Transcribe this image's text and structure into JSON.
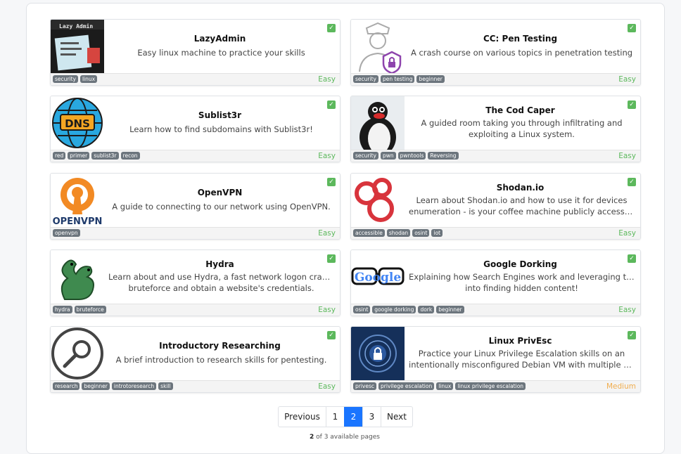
{
  "cards": [
    {
      "title": "LazyAdmin",
      "desc1": "Easy linux machine to practice your skills",
      "desc2": "",
      "tags": [
        "security",
        "linux"
      ],
      "difficulty": "Easy",
      "completed": true,
      "image": "lazyadmin-icon",
      "thumb_text": "Lazy Admin"
    },
    {
      "title": "CC: Pen Testing",
      "desc1": "A crash course on various topics in penetration testing",
      "desc2": "",
      "tags": [
        "security",
        "pen testing",
        "beginner"
      ],
      "difficulty": "Easy",
      "completed": true,
      "image": "security-guard-icon"
    },
    {
      "title": "Sublist3r",
      "desc1": "Learn how to find subdomains with Sublist3r!",
      "desc2": "",
      "tags": [
        "red",
        "primer",
        "sublist3r",
        "recon"
      ],
      "difficulty": "Easy",
      "completed": true,
      "image": "dns-globe-icon",
      "thumb_text": "DNS"
    },
    {
      "title": "The Cod Caper",
      "desc1": "A guided room taking you through infiltrating and",
      "desc2": "exploiting a Linux system.",
      "tags": [
        "security",
        "pwn",
        "pwntools",
        "Reversing"
      ],
      "difficulty": "Easy",
      "completed": true,
      "image": "penguin-icon"
    },
    {
      "title": "OpenVPN",
      "desc1": "A guide to connecting to our network using OpenVPN.",
      "desc2": "",
      "tags": [
        "openvpn"
      ],
      "difficulty": "Easy",
      "completed": true,
      "image": "openvpn-logo-icon",
      "thumb_text": "OPENVPN"
    },
    {
      "title": "Shodan.io",
      "desc1": "Learn about Shodan.io and how to use it for devices",
      "desc2": "enumeration - is your coffee machine publicly accessible?",
      "tags": [
        "accessible",
        "shodan",
        "osint",
        "iot"
      ],
      "difficulty": "Easy",
      "completed": true,
      "image": "shodan-logo-icon"
    },
    {
      "title": "Hydra",
      "desc1": "Learn about and use Hydra, a fast network logon cracker, to",
      "desc2": "bruteforce and obtain a website's credentials.",
      "tags": [
        "hydra",
        "bruteforce"
      ],
      "difficulty": "Easy",
      "completed": true,
      "image": "hydra-dragon-icon"
    },
    {
      "title": "Google Dorking",
      "desc1": "Explaining how Search Engines work and leveraging them",
      "desc2": "into finding hidden content!",
      "tags": [
        "osint",
        "google dorking",
        "dork",
        "beginner"
      ],
      "difficulty": "Easy",
      "completed": true,
      "image": "google-glasses-icon",
      "thumb_text": "Google"
    },
    {
      "title": "Introductory Researching",
      "desc1": "A brief introduction to research skills for pentesting.",
      "desc2": "",
      "tags": [
        "research",
        "beginner",
        "introtoresearch",
        "skill"
      ],
      "difficulty": "Easy",
      "completed": true,
      "image": "magnifier-icon"
    },
    {
      "title": "Linux PrivEsc",
      "desc1": "Practice your Linux Privilege Escalation skills on an",
      "desc2": "intentionally misconfigured Debian VM with multiple wa...",
      "tags": [
        "privesc",
        "privilege escalation",
        "linux",
        "linux privilege escalation"
      ],
      "difficulty": "Medium",
      "completed": true,
      "image": "lock-circuit-icon"
    }
  ],
  "pagination": {
    "previous": "Previous",
    "pages": [
      "1",
      "2",
      "3"
    ],
    "current": "2",
    "next": "Next",
    "info_current": "2",
    "info_text": " of 3 available pages"
  },
  "colors": {
    "easy": "#5cb85c",
    "medium": "#f0ad4e",
    "accent": "#1a75ff",
    "check": "#5cb85c",
    "tag": "#6c757d"
  }
}
